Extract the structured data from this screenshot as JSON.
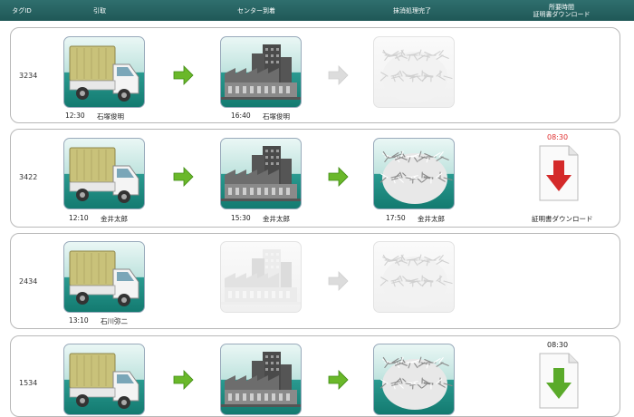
{
  "header": {
    "tag_id": "タグID",
    "pickup": "引取",
    "center_arrival": "センター到着",
    "erasure_done": "抹消処理完了",
    "duration_l1": "所要時間",
    "duration_l2": "証明書ダウンロード"
  },
  "rows": [
    {
      "tag_id": "3234",
      "pickup": {
        "time": "12:30",
        "name": "石塚俊明"
      },
      "arrival": {
        "time": "16:40",
        "name": "石塚俊明",
        "active": true
      },
      "erasure": {
        "time": "",
        "name": "",
        "active": false
      }
    },
    {
      "tag_id": "3422",
      "pickup": {
        "time": "12:10",
        "name": "金井太郎"
      },
      "arrival": {
        "time": "15:30",
        "name": "金井太郎",
        "active": true
      },
      "erasure": {
        "time": "17:50",
        "name": "金井太郎",
        "active": true
      },
      "duration": "08:30",
      "certificate_label": "証明書ダウンロード"
    },
    {
      "tag_id": "2434",
      "pickup": {
        "time": "13:10",
        "name": "石川弥二"
      },
      "arrival": {
        "active": false
      },
      "erasure": {
        "active": false
      }
    },
    {
      "tag_id": "1534",
      "arrival": {
        "active": true
      },
      "erasure": {
        "active": true
      },
      "duration": "08:30"
    }
  ],
  "colors": {
    "header_bg": "#1f5857",
    "duration_active": "#e03030",
    "arrow_active": "#6ab82a",
    "arrow_inactive": "#dcdcdc",
    "download_red": "#d42a2a",
    "download_green": "#5aaa2a"
  },
  "icons": [
    "truck-icon",
    "factory-icon",
    "shredded-paper-icon",
    "right-arrow-icon",
    "pdf-download-icon"
  ]
}
